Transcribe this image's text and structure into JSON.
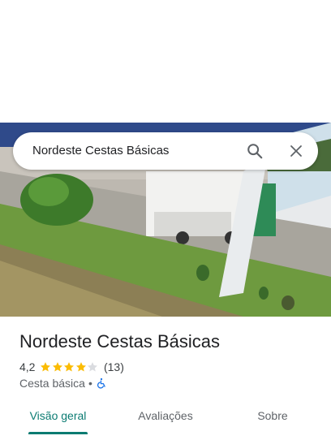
{
  "search": {
    "query": "Nordeste Cestas Básicas"
  },
  "place": {
    "name": "Nordeste Cestas Básicas",
    "rating": "4,2",
    "rating_value": 4.2,
    "review_count": "(13)",
    "category": "Cesta básica",
    "separator": "•"
  },
  "tabs": [
    {
      "label": "Visão geral",
      "active": true
    },
    {
      "label": "Avaliações",
      "active": false
    },
    {
      "label": "Sobre",
      "active": false
    }
  ],
  "colors": {
    "accent": "#0b7b72",
    "star": "#fbbc04",
    "star_empty": "#dadce0",
    "accessibility": "#1a73e8"
  },
  "icons": {
    "search": "search-icon",
    "close": "close-icon",
    "accessibility": "wheelchair-icon"
  }
}
